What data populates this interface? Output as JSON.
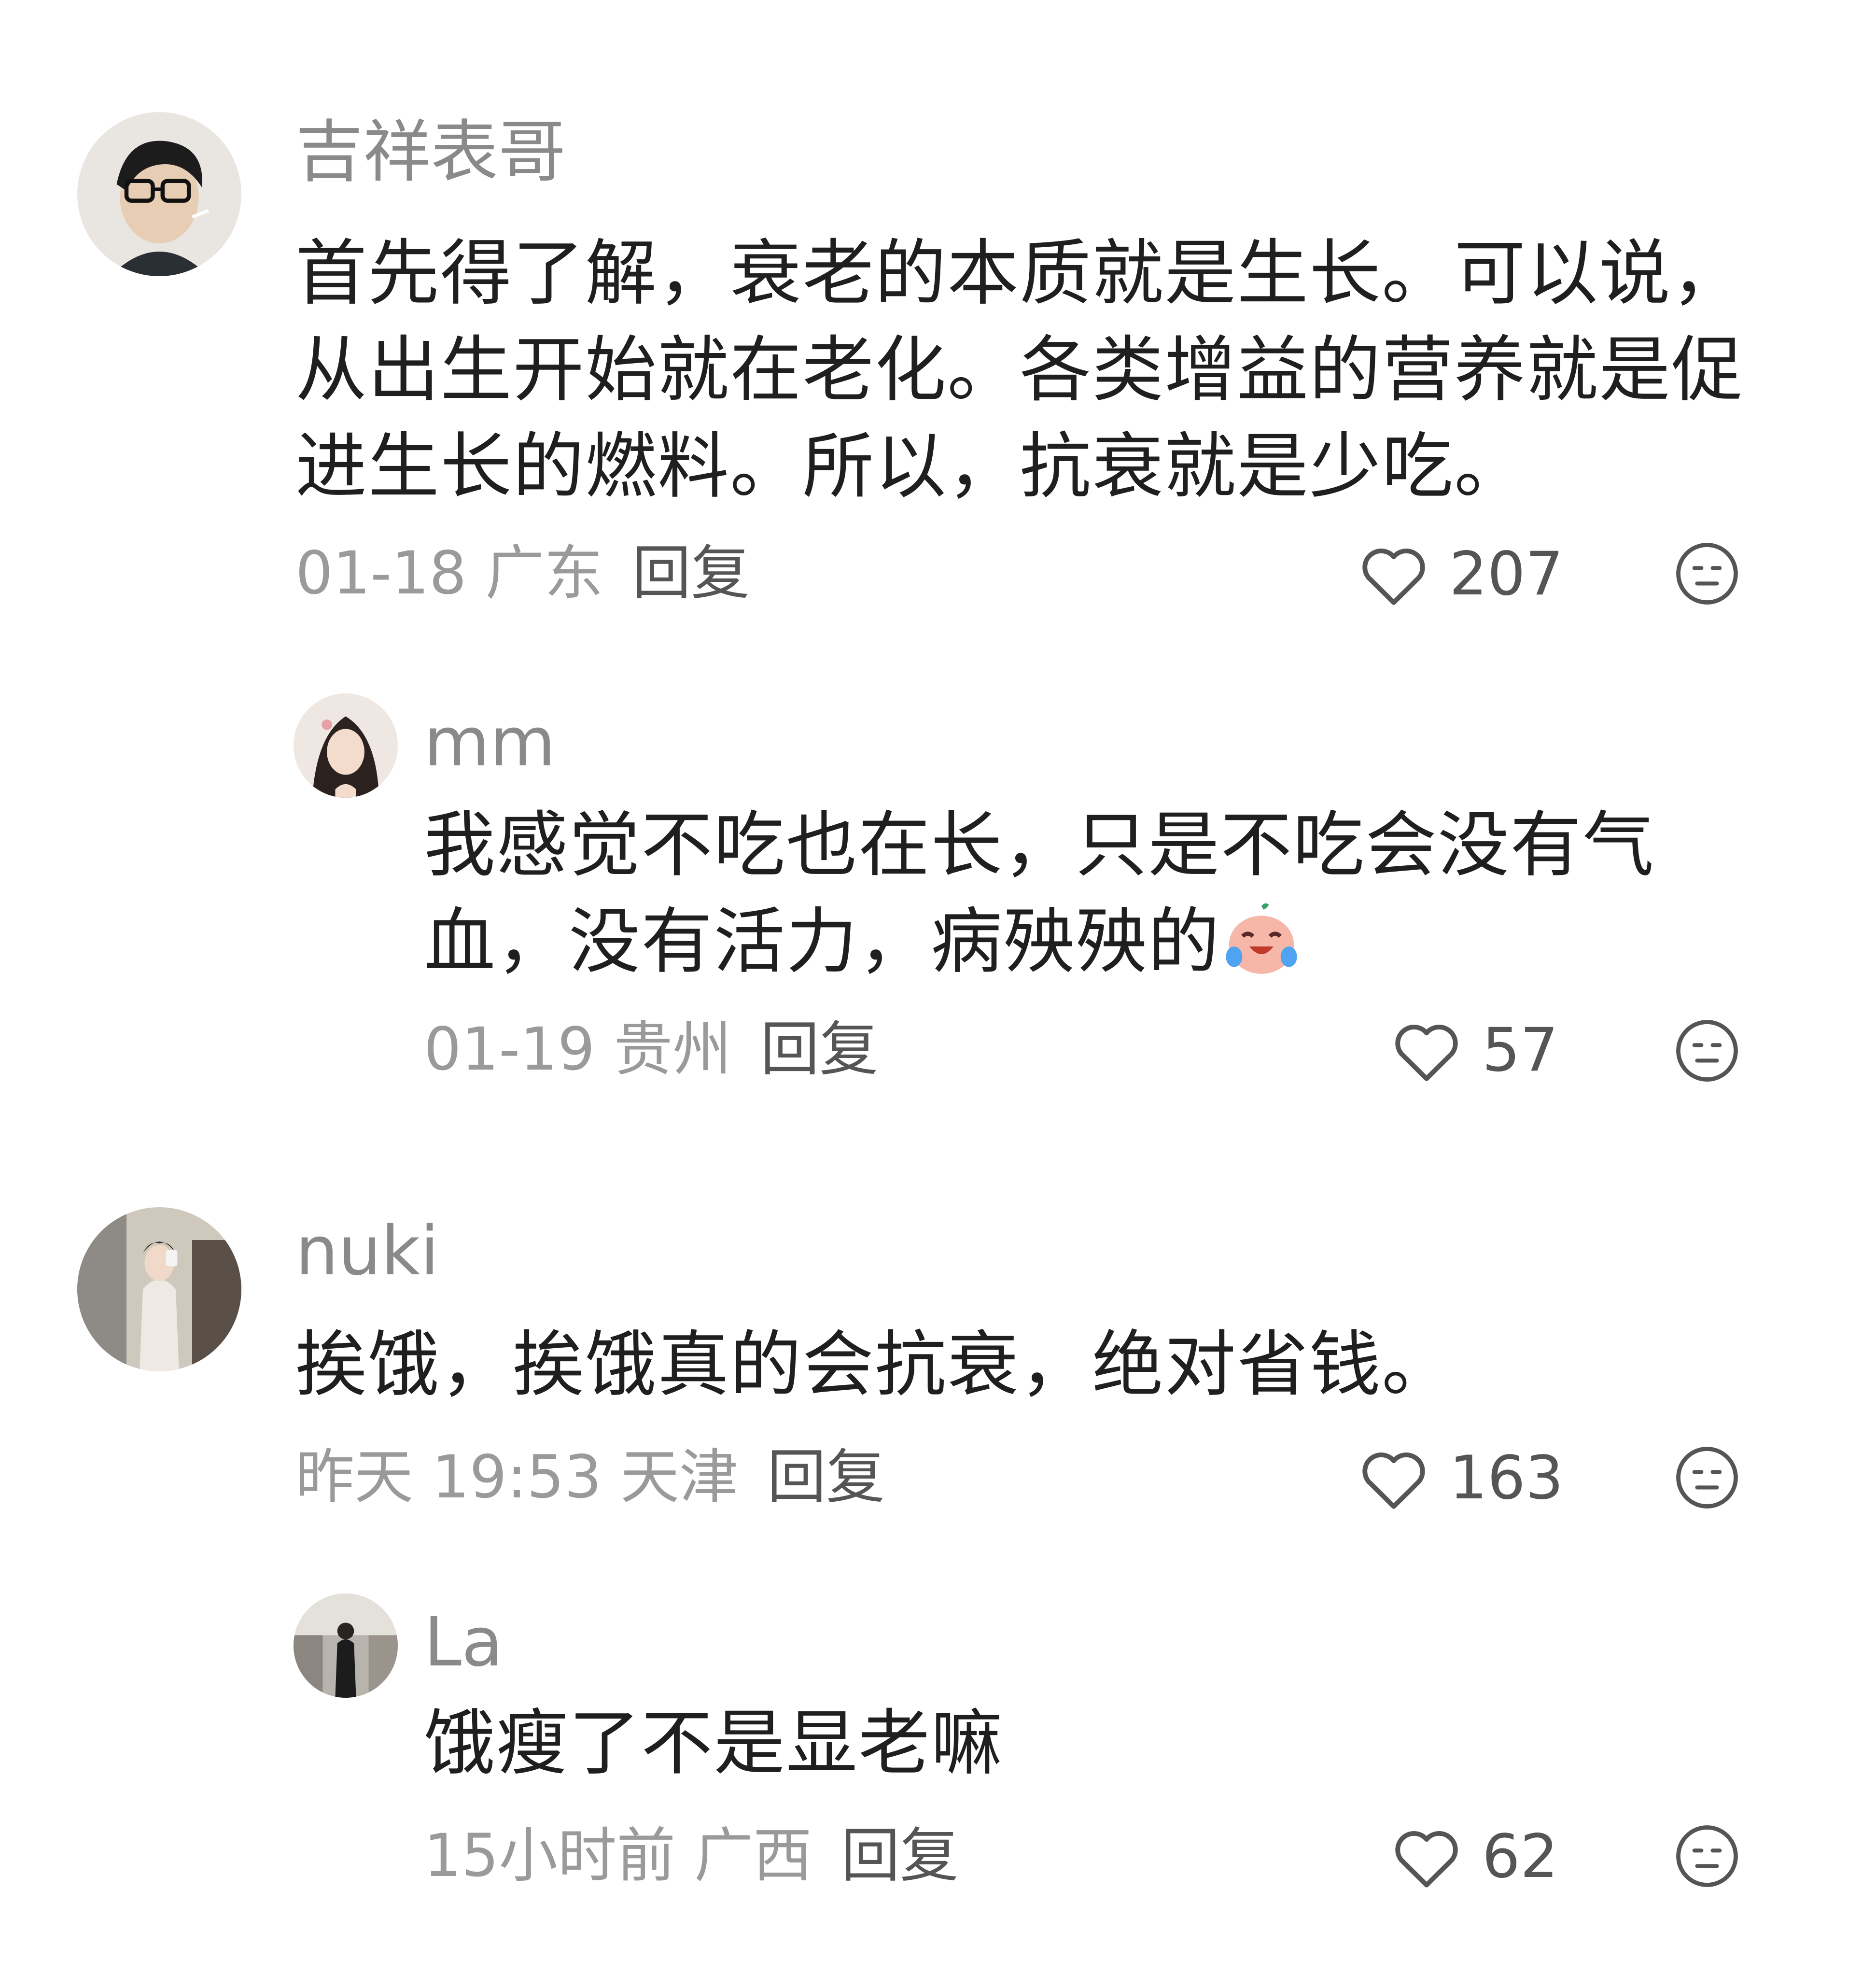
{
  "comments": [
    {
      "username": "吉祥表哥",
      "text": "首先得了解，衰老的本质就是生长。可以说，从出生开始就在老化。各类增益的营养就是促进生长的燃料。所以，抗衰就是少吃。",
      "date_location": "01-18 广东",
      "reply_label": "回复",
      "likes": "207"
    },
    {
      "username": "mm",
      "text": "我感觉不吃也在长，只是不吃会没有气血，没有活力，病殃殃的",
      "emoji": "crying-laughing-emoji",
      "date_location": "01-19 贵州",
      "reply_label": "回复",
      "likes": "57"
    },
    {
      "username": "nuki",
      "text": "挨饿，挨饿真的会抗衰，绝对省钱。",
      "date_location": "昨天 19:53 天津",
      "reply_label": "回复",
      "likes": "163"
    },
    {
      "username": "La",
      "text": "饿瘦了不是显老嘛",
      "date_location": "15小时前 广西",
      "reply_label": "回复",
      "likes": "62"
    }
  ],
  "icons": {
    "like": "heart-outline-icon",
    "dislike": "meh-face-icon"
  },
  "colors": {
    "username": "#8a8a8a",
    "body": "#1f1f1f",
    "meta": "#9a9a9a",
    "reply": "#555555"
  }
}
